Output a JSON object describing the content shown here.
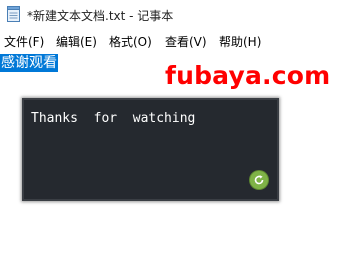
{
  "window": {
    "title": "*新建文本文档.txt - 记事本",
    "icon": "notepad-icon"
  },
  "menu": {
    "items": [
      {
        "label": "文件(F)"
      },
      {
        "label": "编辑(E)"
      },
      {
        "label": "格式(O)"
      },
      {
        "label": "查看(V)"
      },
      {
        "label": "帮助(H)"
      }
    ]
  },
  "editor": {
    "selected_text": "感谢观看",
    "selection_color": "#0078d7"
  },
  "watermark": {
    "text": "fubaya.com",
    "color": "#ff0000"
  },
  "popup": {
    "message": "Thanks  for  watching",
    "background": "#25292f",
    "button_icon": "refresh-icon",
    "button_color": "#7fb347"
  }
}
